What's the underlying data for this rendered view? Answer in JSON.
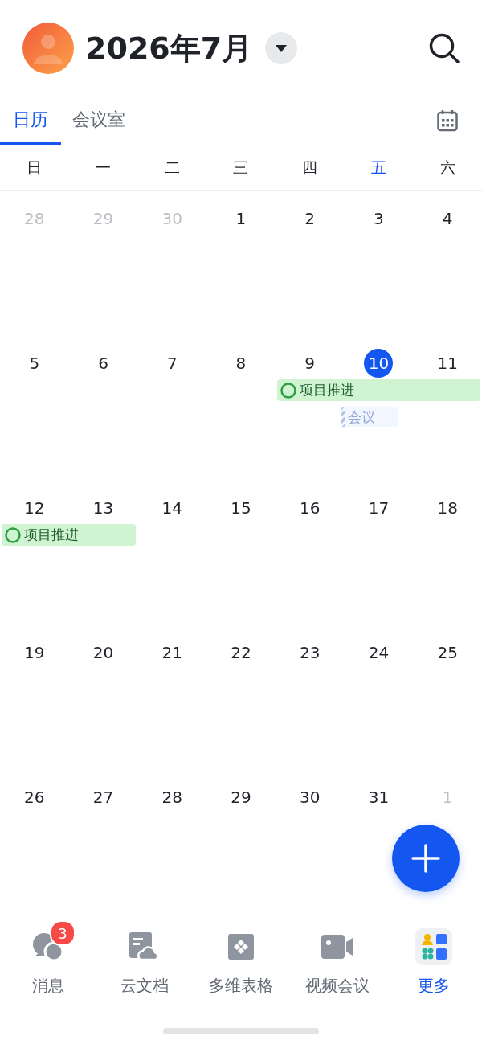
{
  "header": {
    "title": "2026年7月"
  },
  "tabs": [
    {
      "label": "日历",
      "selected": true
    },
    {
      "label": "会议室",
      "selected": false
    }
  ],
  "weekdays": [
    {
      "label": "日",
      "selected": false
    },
    {
      "label": "一",
      "selected": false
    },
    {
      "label": "二",
      "selected": false
    },
    {
      "label": "三",
      "selected": false
    },
    {
      "label": "四",
      "selected": false
    },
    {
      "label": "五",
      "selected": true
    },
    {
      "label": "六",
      "selected": false
    }
  ],
  "weeks": [
    {
      "days": [
        {
          "label": "28",
          "in_month": false,
          "today": false
        },
        {
          "label": "29",
          "in_month": false,
          "today": false
        },
        {
          "label": "30",
          "in_month": false,
          "today": false
        },
        {
          "label": "1",
          "in_month": true,
          "today": false
        },
        {
          "label": "2",
          "in_month": true,
          "today": false
        },
        {
          "label": "3",
          "in_month": true,
          "today": false
        },
        {
          "label": "4",
          "in_month": true,
          "today": false
        }
      ]
    },
    {
      "days": [
        {
          "label": "5",
          "in_month": true,
          "today": false
        },
        {
          "label": "6",
          "in_month": true,
          "today": false
        },
        {
          "label": "7",
          "in_month": true,
          "today": false
        },
        {
          "label": "8",
          "in_month": true,
          "today": false
        },
        {
          "label": "9",
          "in_month": true,
          "today": false,
          "events": [
            {
              "title": "项目推进",
              "kind": "confirmed"
            }
          ]
        },
        {
          "label": "10",
          "in_month": true,
          "today": true,
          "events": [
            {
              "kind": "confirmed",
              "continued": true
            },
            {
              "title": "会议",
              "kind": "tentative"
            }
          ]
        },
        {
          "label": "11",
          "in_month": true,
          "today": false,
          "events": [
            {
              "kind": "confirmed",
              "continued": true
            }
          ]
        }
      ]
    },
    {
      "days": [
        {
          "label": "12",
          "in_month": true,
          "today": false,
          "events": [
            {
              "title": "项目推进",
              "kind": "confirmed"
            }
          ]
        },
        {
          "label": "13",
          "in_month": true,
          "today": false,
          "events": [
            {
              "kind": "confirmed",
              "continued": true
            }
          ]
        },
        {
          "label": "14",
          "in_month": true,
          "today": false
        },
        {
          "label": "15",
          "in_month": true,
          "today": false
        },
        {
          "label": "16",
          "in_month": true,
          "today": false
        },
        {
          "label": "17",
          "in_month": true,
          "today": false
        },
        {
          "label": "18",
          "in_month": true,
          "today": false
        }
      ]
    },
    {
      "days": [
        {
          "label": "19",
          "in_month": true,
          "today": false
        },
        {
          "label": "20",
          "in_month": true,
          "today": false
        },
        {
          "label": "21",
          "in_month": true,
          "today": false
        },
        {
          "label": "22",
          "in_month": true,
          "today": false
        },
        {
          "label": "23",
          "in_month": true,
          "today": false
        },
        {
          "label": "24",
          "in_month": true,
          "today": false
        },
        {
          "label": "25",
          "in_month": true,
          "today": false
        }
      ]
    },
    {
      "days": [
        {
          "label": "26",
          "in_month": true,
          "today": false
        },
        {
          "label": "27",
          "in_month": true,
          "today": false
        },
        {
          "label": "28",
          "in_month": true,
          "today": false
        },
        {
          "label": "29",
          "in_month": true,
          "today": false
        },
        {
          "label": "30",
          "in_month": true,
          "today": false
        },
        {
          "label": "31",
          "in_month": true,
          "today": false
        },
        {
          "label": "1",
          "in_month": false,
          "today": false
        }
      ]
    }
  ],
  "tab_bar": [
    {
      "label": "消息",
      "selected": false,
      "badge": "3"
    },
    {
      "label": "云文档",
      "selected": false
    },
    {
      "label": "多维表格",
      "selected": false
    },
    {
      "label": "视频会议",
      "selected": false
    },
    {
      "label": "更多",
      "selected": true
    }
  ]
}
